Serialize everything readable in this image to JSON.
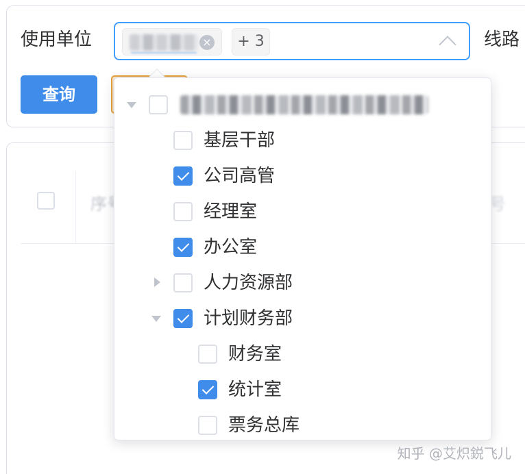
{
  "form": {
    "unit_label": "使用单位",
    "line_label": "线路",
    "selected_tag_close": "×",
    "more_tag": "+ 3",
    "query_button": "查询"
  },
  "table": {
    "ghost_header_text": "序号",
    "ghost_right_text": "号"
  },
  "tree": {
    "nodes": [
      {
        "label": "基层干部",
        "checked": false
      },
      {
        "label": "公司高管",
        "checked": true
      },
      {
        "label": "经理室",
        "checked": false
      },
      {
        "label": "办公室",
        "checked": true
      },
      {
        "label": "人力资源部",
        "checked": false,
        "expandable": true,
        "expanded": false
      },
      {
        "label": "计划财务部",
        "checked": true,
        "expandable": true,
        "expanded": true
      },
      {
        "label": "财务室",
        "checked": false
      },
      {
        "label": "统计室",
        "checked": true
      },
      {
        "label": "票务总库",
        "checked": false
      }
    ]
  },
  "watermark": "知乎 @艾炽鋭飞儿",
  "colors": {
    "primary": "#3f8ceb",
    "border_focus": "#409eff",
    "reset_border": "#e6a23c"
  }
}
